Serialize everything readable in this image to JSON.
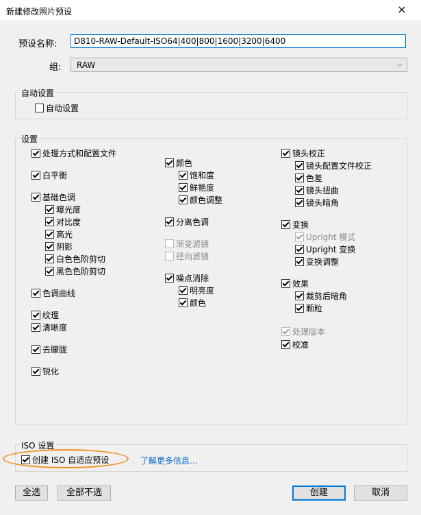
{
  "window": {
    "title": "新建修改照片预设",
    "close_glyph": "✕"
  },
  "preset": {
    "name_label": "预设名称:",
    "name_value": "D810-RAW-Default-ISO64|400|800|1600|3200|6400",
    "group_label": "组:",
    "group_value": "RAW",
    "group_arrow": "⌵"
  },
  "auto": {
    "title": "自动设置",
    "checkbox_label": "自动设置"
  },
  "settings": {
    "title": "设置",
    "col1": {
      "process": "处理方式和配置文件",
      "wb": "白平衡",
      "basic": "基础色调",
      "exposure": "曝光度",
      "contrast": "对比度",
      "highlights": "高光",
      "shadows": "阴影",
      "whites": "白色色阶剪切",
      "blacks": "黑色色阶剪切",
      "tone_curve": "色调曲线",
      "texture": "纹理",
      "clarity": "清晰度",
      "dehaze": "去朦胧",
      "sharpen": "锐化"
    },
    "col2": {
      "color": "颜色",
      "saturation": "饱和度",
      "vibrance": "鲜艳度",
      "color_adjust": "颜色调整",
      "split_toning": "分离色调",
      "graduated": "渐变滤镜",
      "radial": "径向滤镜",
      "noise": "噪点消除",
      "luminance": "明亮度",
      "noise_color": "颜色"
    },
    "col3": {
      "lens": "镜头校正",
      "lens_profile": "镜头配置文件校正",
      "chromatic": "色差",
      "distortion": "镜头扭曲",
      "vignette": "镜头暗角",
      "transform": "变换",
      "upright_mode": "Upright 模式",
      "upright_transform": "Upright 变换",
      "transform_adjust": "变换调整",
      "effects": "效果",
      "crop_vignette": "裁剪后暗角",
      "grain": "颗粒",
      "process_version": "处理版本",
      "calibration": "校准"
    }
  },
  "iso": {
    "title": "ISO 设置",
    "checkbox_label": "创建 ISO 自适应预设",
    "link": "了解更多信息..."
  },
  "buttons": {
    "select_all": "全选",
    "select_none": "全部不选",
    "create": "创建",
    "cancel": "取消"
  },
  "colors": {
    "accent": "#0078d7",
    "highlight_ring": "#f0901e",
    "link": "#0066cc"
  }
}
